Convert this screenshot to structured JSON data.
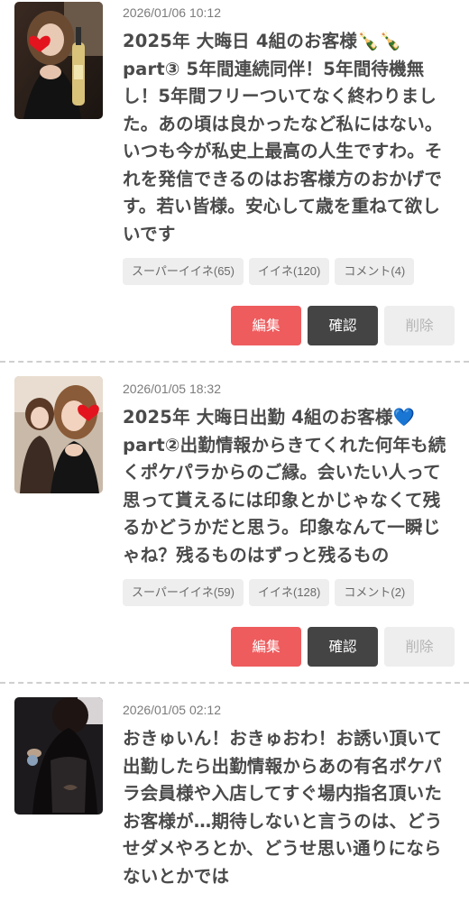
{
  "colors": {
    "edit_button": "#ee5c5e",
    "confirm_button": "#444444",
    "delete_button": "#eeeeee",
    "badge_bg": "#eeeeee",
    "divider": "#cfcfcf"
  },
  "posts": [
    {
      "date": "2026/01/06 10:12",
      "text": "2025年 大晦日 4組のお客様",
      "emoji": "🍾🍾",
      "text_rest": "part③ 5年間連続同伴！5年間待機無し！5年間フリーついてなく終わりました。あの頃は良かったなど私にはない。いつも今が私史上最高の人生ですわ。それを発信できるのはお客様方のおかげです。若い皆様。安心して歳を重ねて欲しいです",
      "super_like": "スーパーイイネ(65)",
      "like": "イイネ(120)",
      "comment": "コメント(4)",
      "edit_label": "編集",
      "confirm_label": "確認",
      "delete_label": "削除"
    },
    {
      "date": "2026/01/05 18:32",
      "text": "2025年 大晦日出勤 4組のお客様",
      "emoji": "💙",
      "text_rest": "part②出勤情報からきてくれた何年も続くポケパラからのご縁。会いたい人って思って貰えるには印象とかじゃなくて残るかどうかだと思う。印象なんて一瞬じゃね？残るものはずっと残るもの",
      "super_like": "スーパーイイネ(59)",
      "like": "イイネ(128)",
      "comment": "コメント(2)",
      "edit_label": "編集",
      "confirm_label": "確認",
      "delete_label": "削除"
    },
    {
      "date": "2026/01/05 02:12",
      "text": "おきゅいん！おきゅおわ！お誘い頂いて出勤したら出勤情報からあの有名ポケパラ会員様や入店してすぐ場内指名頂いたお客様が…期待しないと言うのは、どうせダメやろとか、どうせ思い通りにならないとかでは",
      "emoji": "",
      "text_rest": ""
    }
  ]
}
